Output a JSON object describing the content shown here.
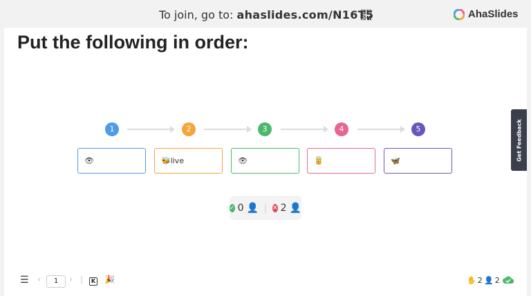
{
  "header": {
    "join_prefix": "To join, go to:",
    "join_url": "ahaslides.com/N16T5",
    "logo_text": "AhaSlides"
  },
  "slide": {
    "title": "Put the following in order:",
    "steps": [
      {
        "number": "1",
        "color": "#4f9be6"
      },
      {
        "number": "2",
        "color": "#f4a63a"
      },
      {
        "number": "3",
        "color": "#4cb86b"
      },
      {
        "number": "4",
        "color": "#e8658f"
      },
      {
        "number": "5",
        "color": "#6a55b8"
      }
    ],
    "items": [
      {
        "text": "👁",
        "border": "#4f9be6"
      },
      {
        "text": "🐝live",
        "border": "#f4a63a"
      },
      {
        "text": "👁",
        "border": "#4cb86b"
      },
      {
        "text": "🥫",
        "border": "#e8658f"
      },
      {
        "text": "🦋",
        "border": "#6a55b8"
      }
    ],
    "result": {
      "correct": "0",
      "incorrect": "2"
    }
  },
  "feedback_label": "Get Feedback",
  "footer": {
    "page_number": "1",
    "hand_count": "2",
    "audience_count": "2"
  }
}
